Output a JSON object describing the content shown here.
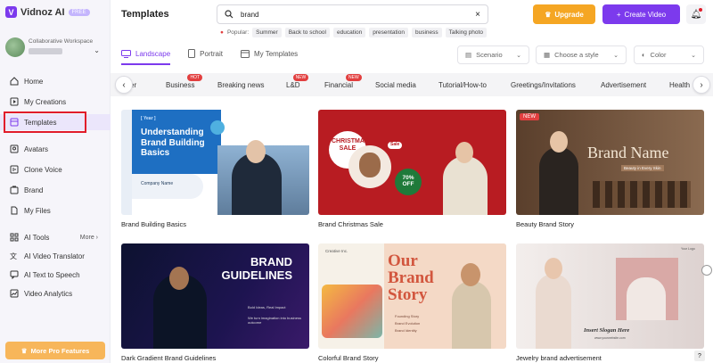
{
  "app": {
    "name": "Vidnoz AI",
    "plan_badge": "FREE"
  },
  "workspace": {
    "label": "Collaborative Workspace"
  },
  "nav": {
    "home": "Home",
    "my_creations": "My Creations",
    "templates": "Templates",
    "avatars": "Avatars",
    "clone_voice": "Clone Voice",
    "brand": "Brand",
    "my_files": "My Files",
    "ai_tools": "AI Tools",
    "ai_tools_more": "More",
    "ai_video_translator": "AI Video Translator",
    "ai_text_to_speech": "AI Text to Speech",
    "video_analytics": "Video Analytics",
    "pro_features": "More Pro Features"
  },
  "header": {
    "title": "Templates",
    "search_value": "brand",
    "popular_label": "Popular:",
    "popular_tags": [
      "Summer",
      "Back to school",
      "education",
      "presentation",
      "business",
      "Talking photo"
    ],
    "upgrade": "Upgrade",
    "create_video": "Create Video"
  },
  "tabs": {
    "landscape": "Landscape",
    "portrait": "Portrait",
    "my_templates": "My Templates"
  },
  "filters": {
    "scenario": "Scenario",
    "style": "Choose a style",
    "color": "Color"
  },
  "categories": [
    {
      "label": "er"
    },
    {
      "label": "Business",
      "badge": "HOT"
    },
    {
      "label": "Breaking news"
    },
    {
      "label": "L&D",
      "badge": "NEW"
    },
    {
      "label": "Financial",
      "badge": "NEW"
    },
    {
      "label": "Social media"
    },
    {
      "label": "Tutorial/How-to"
    },
    {
      "label": "Greetings/Invitations"
    },
    {
      "label": "Advertisement"
    },
    {
      "label": "Health"
    }
  ],
  "templates": [
    {
      "caption": "Brand Building Basics",
      "thumb_tag": "[ Year ]",
      "thumb_title": "Understanding Brand Building Basics",
      "thumb_sub": "Company Name"
    },
    {
      "caption": "Brand Christmas Sale",
      "thumb_title": "CHRISTMAS SALE",
      "thumb_sale": "Sale",
      "thumb_off": "70% OFF"
    },
    {
      "caption": "Beauty Brand Story",
      "badge": "NEW",
      "thumb_title": "Brand Name",
      "thumb_sub": "Beauty in Every Skin"
    },
    {
      "caption": "Dark Gradient Brand Guidelines",
      "thumb_title": "BRAND GUIDELINES",
      "thumb_sub1": "Bold Ideas, Real Impact",
      "thumb_sub2": "We turn imagination into business outcome"
    },
    {
      "caption": "Colorful Brand Story",
      "thumb_logo": "Creative Inc.",
      "thumb_title": "Our Brand Story",
      "thumb_items": [
        "Founding Story",
        "Brand Evolution",
        "Brand Identity"
      ]
    },
    {
      "caption": "Jewelry brand advertisement",
      "thumb_title": "Insert Slogan Here",
      "thumb_sub": "www.yourwebsite.com",
      "thumb_logo": "Your Logo"
    }
  ],
  "colors": {
    "accent": "#7c3aed",
    "upgrade": "#f5a623",
    "highlight": "#e11d2a"
  }
}
